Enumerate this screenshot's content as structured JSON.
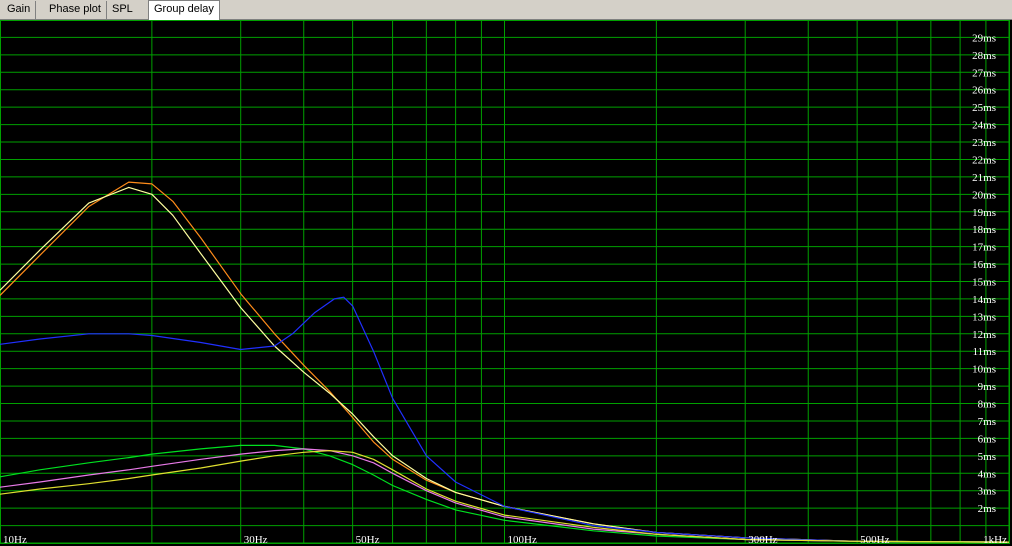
{
  "tabs": [
    {
      "label": "Gain",
      "active": false
    },
    {
      "label": "Phase plot",
      "active": false
    },
    {
      "label": "SPL",
      "active": false
    },
    {
      "label": "Group delay",
      "active": true
    }
  ],
  "colors": {
    "background": "#000000",
    "grid": "#00a000",
    "text": "#ffffff"
  },
  "chart_data": {
    "type": "line",
    "title": "",
    "xlabel": "",
    "ylabel": "",
    "x_scale": "log",
    "xlim": [
      10,
      1000
    ],
    "ylim": [
      0,
      30
    ],
    "grid": true,
    "x_tick_labels": [
      {
        "value": 10,
        "label": "10Hz"
      },
      {
        "value": 30,
        "label": "30Hz"
      },
      {
        "value": 50,
        "label": "50Hz"
      },
      {
        "value": 100,
        "label": "100Hz"
      },
      {
        "value": 300,
        "label": "300Hz"
      },
      {
        "value": 500,
        "label": "500Hz"
      },
      {
        "value": 1000,
        "label": "1kHz"
      }
    ],
    "y_tick_labels": [
      {
        "value": 2,
        "label": "2ms"
      },
      {
        "value": 3,
        "label": "3ms"
      },
      {
        "value": 4,
        "label": "4ms"
      },
      {
        "value": 5,
        "label": "5ms"
      },
      {
        "value": 6,
        "label": "6ms"
      },
      {
        "value": 7,
        "label": "7ms"
      },
      {
        "value": 8,
        "label": "8ms"
      },
      {
        "value": 9,
        "label": "9ms"
      },
      {
        "value": 10,
        "label": "10ms"
      },
      {
        "value": 11,
        "label": "11ms"
      },
      {
        "value": 12,
        "label": "12ms"
      },
      {
        "value": 13,
        "label": "13ms"
      },
      {
        "value": 14,
        "label": "14ms"
      },
      {
        "value": 15,
        "label": "15ms"
      },
      {
        "value": 16,
        "label": "16ms"
      },
      {
        "value": 17,
        "label": "17ms"
      },
      {
        "value": 18,
        "label": "18ms"
      },
      {
        "value": 19,
        "label": "19ms"
      },
      {
        "value": 20,
        "label": "20ms"
      },
      {
        "value": 21,
        "label": "21ms"
      },
      {
        "value": 22,
        "label": "22ms"
      },
      {
        "value": 23,
        "label": "23ms"
      },
      {
        "value": 24,
        "label": "24ms"
      },
      {
        "value": 25,
        "label": "25ms"
      },
      {
        "value": 26,
        "label": "26ms"
      },
      {
        "value": 27,
        "label": "27ms"
      },
      {
        "value": 28,
        "label": "28ms"
      },
      {
        "value": 29,
        "label": "29ms"
      }
    ],
    "series": [
      {
        "color": "#ff8c1a",
        "x": [
          10,
          12,
          15,
          18,
          20,
          22,
          25,
          30,
          35,
          40,
          45,
          50,
          55,
          60,
          70,
          80,
          100,
          150,
          200,
          300,
          500,
          1000
        ],
        "y": [
          14.2,
          16.5,
          19.3,
          20.7,
          20.6,
          19.6,
          17.5,
          14.3,
          12.0,
          10.2,
          8.7,
          7.2,
          5.8,
          4.8,
          3.6,
          2.9,
          2.1,
          1.1,
          0.6,
          0.3,
          0.1,
          0.05
        ]
      },
      {
        "color": "#ffffa0",
        "x": [
          10,
          12,
          15,
          18,
          20,
          22,
          25,
          30,
          35,
          40,
          45,
          50,
          55,
          60,
          70,
          80,
          100,
          150,
          200,
          300,
          500,
          1000
        ],
        "y": [
          14.5,
          16.8,
          19.5,
          20.4,
          20.0,
          18.8,
          16.6,
          13.5,
          11.3,
          9.8,
          8.6,
          7.4,
          6.1,
          5.0,
          3.7,
          2.9,
          2.1,
          1.1,
          0.6,
          0.3,
          0.1,
          0.05
        ]
      },
      {
        "color": "#2030ff",
        "x": [
          10,
          12,
          15,
          18,
          20,
          25,
          30,
          35,
          38,
          42,
          46,
          48,
          50,
          55,
          60,
          70,
          80,
          100,
          150,
          200,
          300,
          500,
          1000
        ],
        "y": [
          11.4,
          11.7,
          12.0,
          12.0,
          11.9,
          11.5,
          11.1,
          11.3,
          12.0,
          13.2,
          14.0,
          14.1,
          13.6,
          11.0,
          8.3,
          5.0,
          3.5,
          2.1,
          1.0,
          0.6,
          0.3,
          0.1,
          0.05
        ]
      },
      {
        "color": "#00e020",
        "x": [
          10,
          12,
          15,
          18,
          20,
          25,
          30,
          35,
          40,
          45,
          50,
          55,
          60,
          70,
          80,
          100,
          150,
          200,
          300,
          500,
          1000
        ],
        "y": [
          3.8,
          4.2,
          4.6,
          4.9,
          5.1,
          5.4,
          5.6,
          5.6,
          5.4,
          5.0,
          4.5,
          3.9,
          3.3,
          2.5,
          1.9,
          1.3,
          0.7,
          0.4,
          0.2,
          0.1,
          0.05
        ]
      },
      {
        "color": "#e87ae8",
        "x": [
          10,
          12,
          15,
          18,
          20,
          25,
          30,
          35,
          40,
          45,
          50,
          55,
          60,
          70,
          80,
          100,
          150,
          200,
          300,
          500,
          1000
        ],
        "y": [
          3.2,
          3.5,
          3.9,
          4.2,
          4.4,
          4.8,
          5.1,
          5.3,
          5.4,
          5.3,
          5.0,
          4.6,
          4.0,
          3.0,
          2.3,
          1.5,
          0.8,
          0.5,
          0.2,
          0.1,
          0.05
        ]
      },
      {
        "color": "#e0e030",
        "x": [
          10,
          12,
          15,
          18,
          20,
          25,
          30,
          35,
          40,
          45,
          50,
          55,
          60,
          70,
          80,
          100,
          150,
          200,
          300,
          500,
          1000
        ],
        "y": [
          2.8,
          3.1,
          3.4,
          3.7,
          3.9,
          4.3,
          4.7,
          5.0,
          5.2,
          5.3,
          5.2,
          4.8,
          4.2,
          3.1,
          2.4,
          1.6,
          0.9,
          0.5,
          0.2,
          0.1,
          0.05
        ]
      }
    ]
  }
}
